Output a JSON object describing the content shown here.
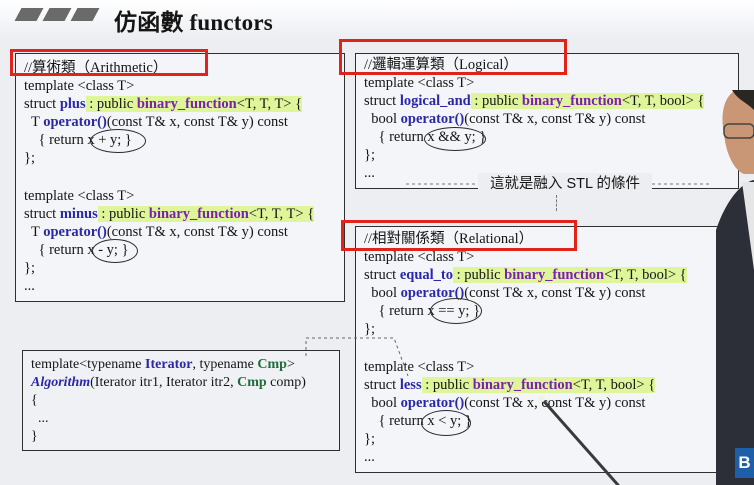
{
  "slide": {
    "title": "仿函數 functors",
    "callout": "這就是融入 STL 的條件"
  },
  "arithmetic": {
    "header": "//算術類（Arithmetic）",
    "lines": [
      "template <class T>",
      "struct ",
      "plus",
      " : public ",
      "binary_function",
      "<T, T, T> {",
      "  T ",
      "operator()",
      "(const T& x, const T& y) const",
      "    { return x + y; }",
      "};",
      "template <class T>",
      "struct ",
      "minus",
      " : public ",
      "binary_function",
      "<T, T, T> {",
      "  T ",
      "operator()",
      "(const T& x, const T& y) const",
      "    { return x - y; }",
      "};",
      "..."
    ]
  },
  "logical": {
    "header": "//邏輯運算類（Logical）",
    "template": "template <class T>",
    "struct_kw": "struct ",
    "name": "logical_and",
    "inherit": " : public ",
    "base": "binary_function",
    "args": "<T, T, bool> {",
    "ret": "  bool ",
    "op": "operator()",
    "params": "(const T& x, const T& y) const",
    "body": "    { return x && y; }",
    "close": "};",
    "ellipsis": "..."
  },
  "relational": {
    "header": "//相對關係類（Relational）",
    "equal_to": {
      "template": "template <class T>",
      "struct_kw": "struct ",
      "name": "equal_to",
      "inherit": " : public ",
      "base": "binary_function",
      "args": "<T, T, bool> {",
      "ret": "  bool ",
      "op": "operator()",
      "params": "(const T& x, const T& y) const",
      "body": "    { return x == y; }",
      "close": "};"
    },
    "less": {
      "template": "template <class T>",
      "struct_kw": "struct ",
      "name": "less",
      "inherit": " : public ",
      "base": "binary_function",
      "args": "<T, T, bool> {",
      "ret": "  bool ",
      "op": "operator()",
      "params": "(const T& x, const T& y) const",
      "body": "    { return x < y; }",
      "close": "};"
    },
    "ellipsis": "..."
  },
  "algorithm": {
    "template_a": "template<typename ",
    "iter_type": "Iterator",
    "template_b": ", typename ",
    "cmp_type": "Cmp",
    "template_c": ">",
    "func": "Algorithm",
    "sig_a": "(Iterator itr1, Iterator itr2, ",
    "sig_cmp": "Cmp",
    "sig_b": " comp)",
    "open": "{",
    "ellipsis": "  ...",
    "close": "}"
  },
  "colors": {
    "emphasis_box": "#e2231a",
    "keyword_blue": "#2a28a8",
    "keyword_purple": "#7a1fb0",
    "highlight": "#dff59a",
    "logo": "#1e5fa8"
  },
  "logo": {
    "letter": "B"
  }
}
